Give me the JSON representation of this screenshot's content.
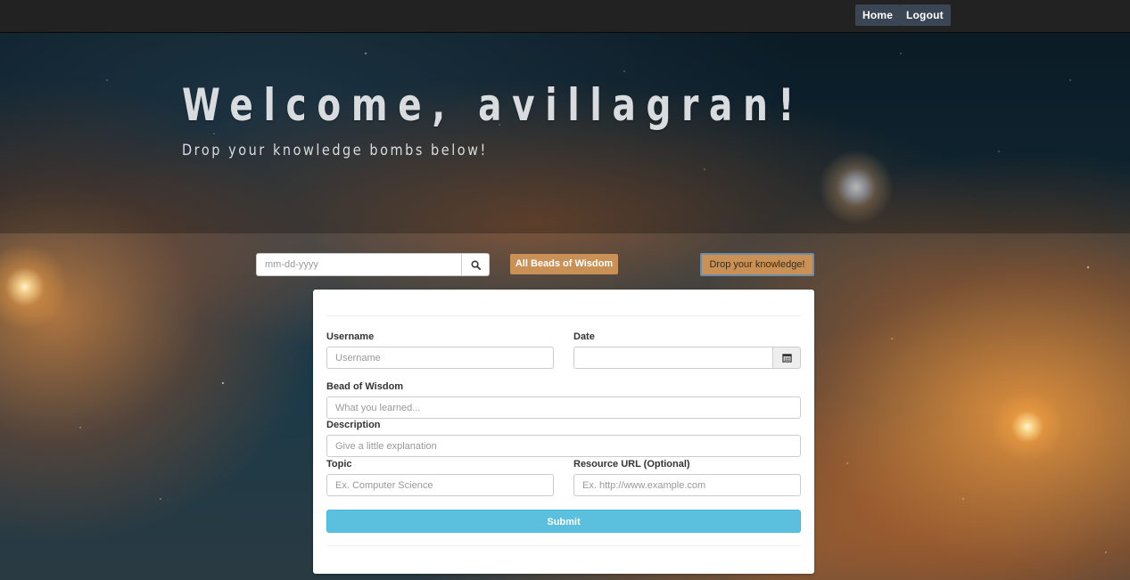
{
  "nav": {
    "home_label": "Home",
    "logout_label": "Logout"
  },
  "hero": {
    "title": "Welcome, avillagran!",
    "subtitle": "Drop your knowledge bombs below!"
  },
  "toolbar": {
    "date_search_placeholder": "mm-dd-yyyy",
    "search_icon": "search-icon",
    "all_beads_label": "All Beads of Wisdom",
    "drop_knowledge_label": "Drop your knowledge!"
  },
  "form": {
    "username_label": "Username",
    "username_placeholder": "Username",
    "date_label": "Date",
    "date_value": "",
    "calendar_icon": "calendar-icon",
    "bead_label": "Bead of Wisdom",
    "bead_placeholder": "What you learned...",
    "description_label": "Description",
    "description_placeholder": "Give a little explanation",
    "topic_label": "Topic",
    "topic_placeholder": "Ex. Computer Science",
    "resource_label": "Resource URL (Optional)",
    "resource_placeholder": "Ex. http://www.example.com",
    "submit_label": "Submit"
  },
  "colors": {
    "topbar": "#222222",
    "nav_button": "#3a4653",
    "accent_button": "#c99156",
    "submit": "#5bc0de"
  }
}
